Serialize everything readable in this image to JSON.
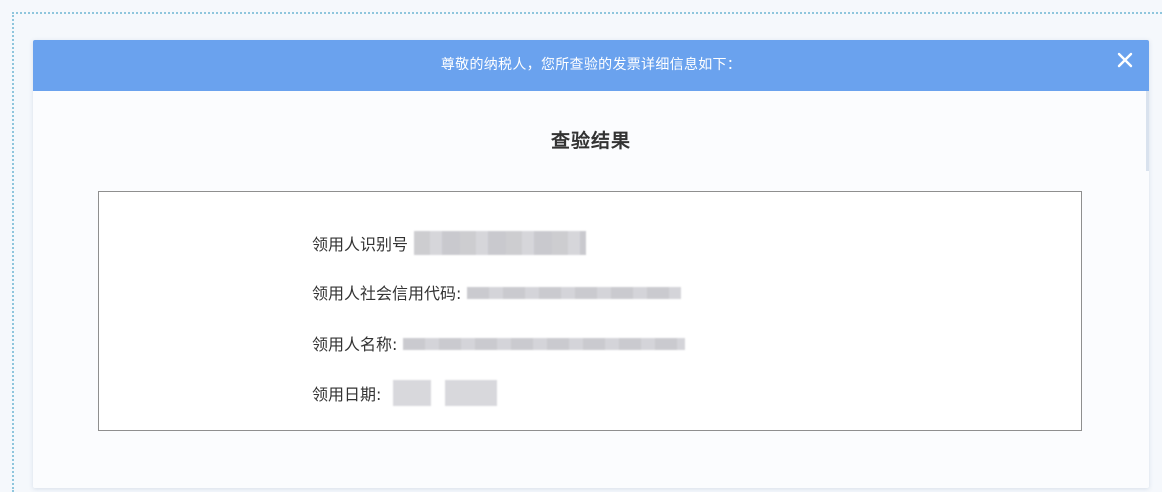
{
  "dialog": {
    "header_text": "尊敬的纳税人，您所查验的发票详细信息如下：",
    "close_symbol": "×",
    "title": "查验结果"
  },
  "result": {
    "fields": [
      {
        "label": "领用人识别号"
      },
      {
        "label": "领用人社会信用代码:"
      },
      {
        "label": "领用人名称:"
      },
      {
        "label": "领用日期:"
      }
    ]
  },
  "colors": {
    "header_bg": "#6aa2ee",
    "header_text": "#ffffff",
    "title_text": "#333333",
    "border": "#8f8f8f"
  }
}
